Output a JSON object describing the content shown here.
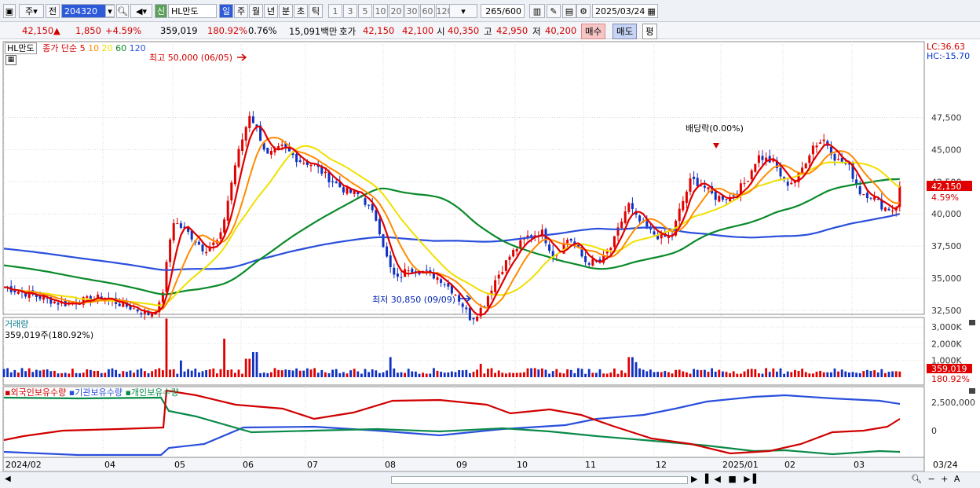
{
  "toolbar": {
    "market_label": "주",
    "prev_label": "전",
    "code": "204320",
    "new_label": "신",
    "name": "HL만도",
    "periods": [
      "일",
      "주",
      "월",
      "년",
      "분",
      "초",
      "틱"
    ],
    "numbers": [
      "1",
      "3",
      "5",
      "10",
      "20",
      "30",
      "60",
      "120"
    ],
    "count": "265",
    "count_total": "/600",
    "date": "2025/03/24"
  },
  "quote": {
    "price": "42,150",
    "arrow": "▲",
    "change": "1,850",
    "change_pct": "+4.59%",
    "volume": "359,019",
    "volume_pct": "180.92%",
    "turnover_pct": "0.76%",
    "amount": "15,091백만",
    "ask_label": "호가",
    "ask": "42,150",
    "bid": "42,100",
    "open_label": "시",
    "open": "40,350",
    "high_label": "고",
    "high": "42,950",
    "low_label": "저",
    "low": "40,200",
    "buy_label": "매수",
    "sell_label": "매도",
    "eval_label": "평"
  },
  "price_panel": {
    "name_tag": "HL만도",
    "ma_label": "종가 단순",
    "ma_periods": [
      "5",
      "10",
      "20",
      "60",
      "120"
    ],
    "ma_colors": [
      "#e00000",
      "#ff8c00",
      "#f0e000",
      "#0a8a2a",
      "#2a4fdc"
    ],
    "lc": "LC:36.63",
    "hc": "HC:-15.70",
    "high_note": "최고 50,000 (06/05)",
    "low_note": "최저 30,850 (09/09)",
    "dividend_note": "배당락(0.00%)",
    "yticks": [
      "47,500",
      "45,000",
      "42,500",
      "40,000",
      "37,500",
      "35,000",
      "32,500"
    ],
    "last_price": "42,150",
    "last_pct": "4.59%"
  },
  "volume_panel": {
    "title": "거래량",
    "value": "359,019주(180.92%)",
    "yticks": [
      "3,000K",
      "2,000K",
      "1,000K"
    ],
    "last": "359,019",
    "last_pct": "180.92%"
  },
  "holding_panel": {
    "legend": [
      "외국인보유수량",
      "기관보유수량",
      "개인보유수량"
    ],
    "colors": [
      "#d00000",
      "#2a4fdc",
      "#0a8a4a"
    ],
    "yticks": [
      "2,500,000",
      "0"
    ]
  },
  "xaxis": {
    "labels": [
      "2024/02",
      "04",
      "05",
      "06",
      "07",
      "08",
      "09",
      "10",
      "11",
      "12",
      "2025/01",
      "02",
      "03"
    ],
    "last": "03/24"
  }
}
